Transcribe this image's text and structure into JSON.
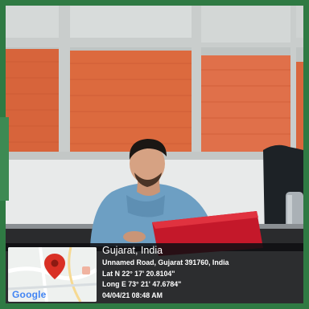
{
  "photo": {
    "subject": "man-with-laptop",
    "colors": {
      "border": "#2f7a43",
      "blinds": "#d9663c",
      "shirt": "#6d9fc3",
      "laptop": "#c4182a",
      "overlay": "#0e0e12"
    }
  },
  "geotag": {
    "location": "Gujarat, India",
    "address": "Unnamed Road, Gujarat 391760, India",
    "latitude": "Lat N 22° 17' 20.8104\"",
    "longitude": "Long E 73° 21' 47.6784\"",
    "datetime": "04/04/21 08:48 AM",
    "map_logo": "Google",
    "pin_icon": "map-pin-icon"
  }
}
